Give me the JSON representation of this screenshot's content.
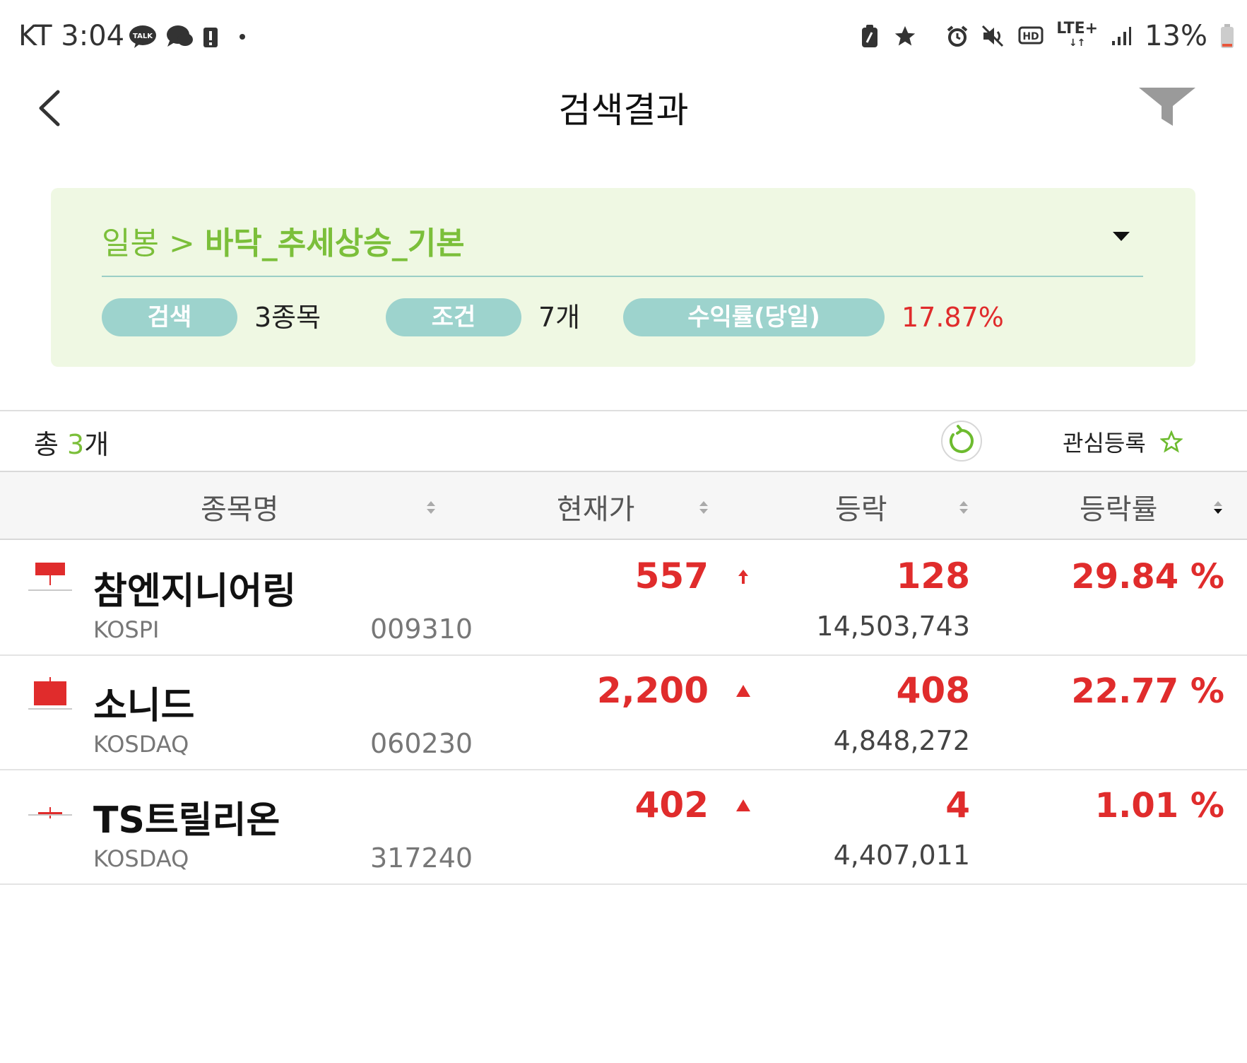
{
  "status_bar": {
    "carrier_time": "KT 3:04",
    "talk_badge": "TALK",
    "network": "LTE+",
    "battery": "13%"
  },
  "header": {
    "title": "검색결과",
    "back_icon": "back-arrow-icon",
    "filter_icon": "filter-icon"
  },
  "summary": {
    "breadcrumb_prefix": "일봉 > ",
    "breadcrumb_name": "바닥_추세상승_기본",
    "search_label": "검색",
    "search_value": "3종목",
    "condition_label": "조건",
    "condition_value": "7개",
    "return_label": "수익률(당일)",
    "return_value": "17.87%"
  },
  "list_toolbar": {
    "total_prefix": "총 ",
    "total_count": "3",
    "total_suffix": "개",
    "watch_label": "관심등록"
  },
  "table": {
    "columns": [
      "종목명",
      "현재가",
      "등락",
      "등락률"
    ],
    "rows": [
      {
        "name": "참엔지니어링",
        "market": "KOSPI",
        "code": "009310",
        "price": "557",
        "change": "128",
        "volume": "14,503,743",
        "rate": "29.84 %",
        "arrow": "upper-limit"
      },
      {
        "name": "소니드",
        "market": "KOSDAQ",
        "code": "060230",
        "price": "2,200",
        "change": "408",
        "volume": "4,848,272",
        "rate": "22.77 %",
        "arrow": "up"
      },
      {
        "name": "TS트릴리온",
        "market": "KOSDAQ",
        "code": "317240",
        "price": "402",
        "change": "4",
        "volume": "4,407,011",
        "rate": "1.01 %",
        "arrow": "up"
      }
    ]
  },
  "colors": {
    "up": "#e02c2c",
    "accent_green": "#7bbf3a",
    "pill": "#9dd3cd",
    "summary_bg": "#eff8e3"
  }
}
